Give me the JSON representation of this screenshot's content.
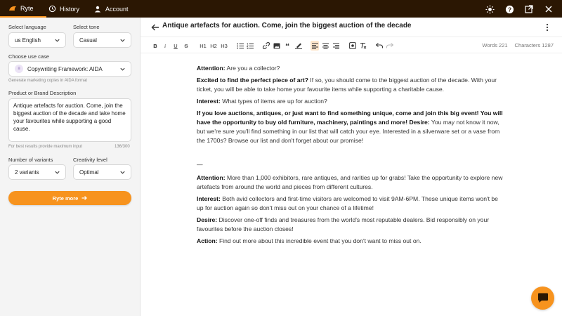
{
  "tabs": [
    {
      "label": "Ryte",
      "icon": "ryte-logo-icon",
      "active": true
    },
    {
      "label": "History",
      "icon": "history-clock-icon"
    },
    {
      "label": "Account",
      "icon": "user-icon"
    }
  ],
  "top_icons": [
    "sun-icon",
    "help-icon",
    "external-link-icon",
    "close-icon"
  ],
  "colors": {
    "accent": "#f7931e",
    "topbar": "#2b1703",
    "sidebar": "#f4f4f4"
  },
  "sidebar": {
    "language_label": "Select language",
    "language_value": "us English",
    "tone_label": "Select tone",
    "tone_value": "Casual",
    "use_case_label": "Choose use case",
    "use_case_value": "Copywriting Framework: AIDA",
    "use_case_hint": "Generate marketing copies in AIDA format",
    "product_label": "Product or Brand Description",
    "product_value": "Antique artefacts for auction. Come, join the biggest auction of the decade and take home your favourites while supporting a good cause.",
    "product_hint": "For best results provide maximum input",
    "char_count": "136/300",
    "variants_label": "Number of variants",
    "variants_value": "2 variants",
    "creativity_label": "Creativity level",
    "creativity_value": "Optimal",
    "ryte_more_label": "Ryte more"
  },
  "editor": {
    "title": "Antique artefacts for auction. Come, join the biggest auction of the decade",
    "toolbar": {
      "bold": "B",
      "italic": "i",
      "underline": "U",
      "strike": "S",
      "h1": "H1",
      "h2": "H2",
      "h3": "H3",
      "quote": "❛❛"
    },
    "words": "Words 221",
    "characters": "Characters 1287",
    "variant1": {
      "attention_label": "Attention:",
      "attention_text": " Are you a collector?",
      "excited_bold": "Excited to find the perfect piece of art?",
      "excited_text": " If so, you should come to the biggest auction of the decade. With your ticket, you will be able to take home your favourite items while supporting a charitable cause.",
      "interest_label": "Interest:",
      "interest_text": " What types of items are up for auction?",
      "love_bold": "If you love auctions, antiques, or just want to find something unique, come and join this big event! You will have the opportunity to buy old furniture, machinery, paintings and more! Desire:",
      "love_text": " You may not know it now, but we're sure you'll find something in our list that will catch your eye. Interested in a silverware set or a vase from the 1700s? Browse our list and don't forget about our promise!"
    },
    "separator": "—",
    "variant2": {
      "attention_label": "Attention:",
      "attention_text": " More than 1,000 exhibitors, rare antiques, and rarities up for grabs! Take the opportunity to explore new artefacts from around the world and pieces from different cultures.",
      "interest_label": "Interest:",
      "interest_text": " Both avid collectors and first-time visitors are welcomed to visit 9AM-6PM. These unique items won't be up for auction again so don't miss out on your chance of a lifetime!",
      "desire_label": "Desire:",
      "desire_text": " Discover one-off finds and treasures from the world's most reputable dealers. Bid responsibly on your favourites before the auction closes!",
      "action_label": "Action:",
      "action_text": " Find out more about this incredible event that you don't want to miss out on."
    }
  }
}
